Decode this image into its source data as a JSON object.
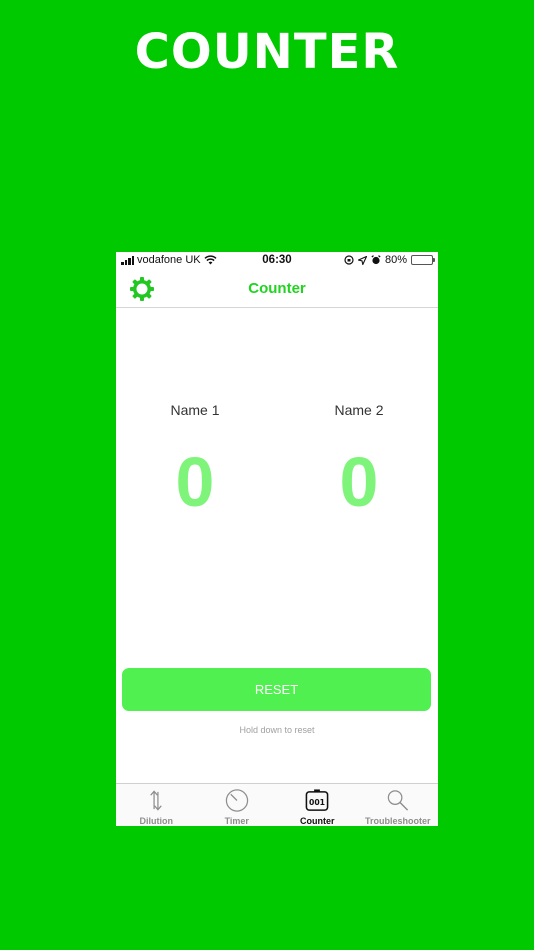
{
  "promo": {
    "title": "COUNTER"
  },
  "status_bar": {
    "carrier": "vodafone UK",
    "time": "06:30",
    "battery_percent": "80%",
    "battery_level": 0.8,
    "icons": [
      "signal-icon",
      "wifi-icon",
      "orientation-lock-icon",
      "location-arrow-icon",
      "alarm-icon",
      "battery-icon"
    ]
  },
  "nav": {
    "title": "Counter",
    "left_icon": "gear-icon"
  },
  "counters": [
    {
      "name": "Name 1",
      "value": "0"
    },
    {
      "name": "Name 2",
      "value": "0"
    }
  ],
  "reset": {
    "label": "RESET",
    "hint": "Hold down to reset"
  },
  "tabs": [
    {
      "label": "Dilution",
      "icon": "dilution-arrows-icon",
      "active": false
    },
    {
      "label": "Timer",
      "icon": "timer-icon",
      "active": false
    },
    {
      "label": "Counter",
      "icon": "counter-icon",
      "active": true
    },
    {
      "label": "Troubleshooter",
      "icon": "magnifier-icon",
      "active": false
    }
  ],
  "colors": {
    "background": "#00c900",
    "accent": "#22d322",
    "counter_value": "#7ef57a",
    "reset_button": "#4ff04f",
    "battery": "#f4c400"
  }
}
